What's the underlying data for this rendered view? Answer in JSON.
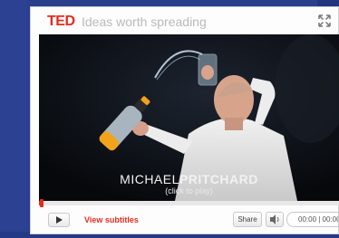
{
  "header": {
    "logo": "TED",
    "tagline": "Ideas worth spreading"
  },
  "video": {
    "speaker_first": "MICHAEL",
    "speaker_last": "PRITCHARD",
    "prompt": "(click to play)"
  },
  "progress": {
    "played_fraction": 0.01
  },
  "controls": {
    "subtitles_label": "View subtitles",
    "share_label": "Share",
    "time": "00:00 | 00:00"
  },
  "icons": {
    "expand": "expand-icon",
    "play": "play-icon",
    "volume": "volume-icon"
  },
  "colors": {
    "ted_red": "#e62b1e",
    "page_blue": "#2a3f8c"
  }
}
